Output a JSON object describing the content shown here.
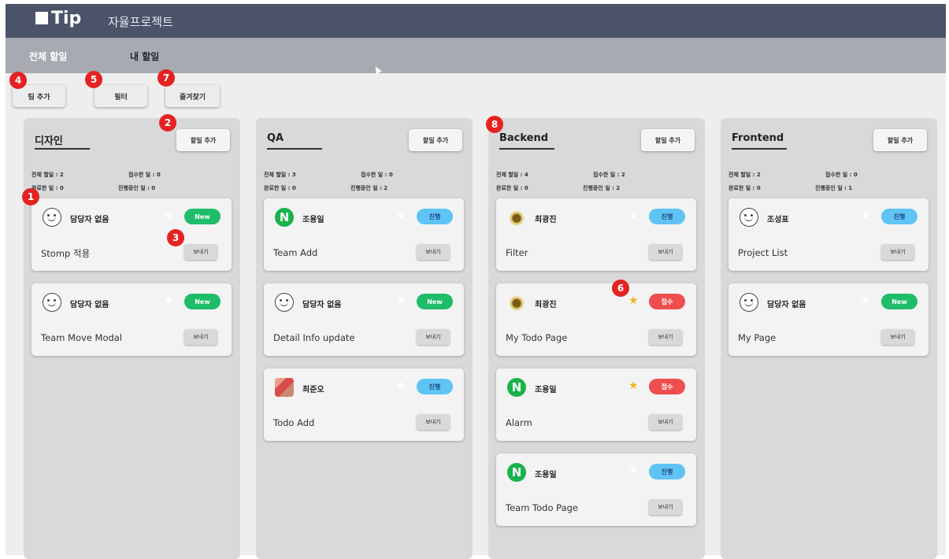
{
  "header": {
    "logo": "Tip",
    "app_title": "자율프로젝트"
  },
  "tabs": [
    {
      "label": "전체 할일"
    },
    {
      "label": "내 할일"
    }
  ],
  "toolbar": {
    "add_team": "팀 추가",
    "filter": "필터",
    "favorites": "즐겨찾기"
  },
  "markers": [
    "1",
    "2",
    "3",
    "4",
    "5",
    "6",
    "7",
    "8"
  ],
  "columns": [
    {
      "title": "디자인",
      "add_label": "할일 추가",
      "stats": {
        "total": "전체 할일 : 2",
        "received": "접수한 일 : 0",
        "done": "완료한 일 : 0",
        "in_progress": "진행중인 일 : 0"
      },
      "cards": [
        {
          "assignee": "담당자 없음",
          "avatar": "smile-icon",
          "status": "New",
          "favorite": false,
          "todo": "Stomp 적용",
          "send": "보내기"
        },
        {
          "assignee": "담당자 없음",
          "avatar": "smile-icon",
          "status": "New",
          "favorite": false,
          "todo": "Team Move Modal",
          "send": "보내기"
        }
      ]
    },
    {
      "title": "QA",
      "add_label": "할일 추가",
      "stats": {
        "total": "전체 할일 : 3",
        "received": "접수한 일 : 0",
        "done": "완료한 일 : 0",
        "in_progress": "진행중인 일 : 2"
      },
      "cards": [
        {
          "assignee": "조용일",
          "avatar": "naver-icon",
          "status": "진행",
          "favorite": false,
          "todo": "Team Add",
          "send": "보내기"
        },
        {
          "assignee": "담당자 없음",
          "avatar": "smile-icon",
          "status": "New",
          "favorite": false,
          "todo": "Detail Info update",
          "send": "보내기"
        },
        {
          "assignee": "최준오",
          "avatar": "pixel-avatar-icon",
          "status": "진행",
          "favorite": false,
          "todo": "Todo Add",
          "send": "보내기"
        }
      ]
    },
    {
      "title": "Backend",
      "add_label": "할일 추가",
      "stats": {
        "total": "전체 할일 : 4",
        "received": "접수한 일 : 2",
        "done": "완료한 일 : 0",
        "in_progress": "진행중인 일 : 2"
      },
      "cards": [
        {
          "assignee": "최광진",
          "avatar": "bird-icon",
          "status": "진행",
          "favorite": false,
          "todo": "Filter",
          "send": "보내기"
        },
        {
          "assignee": "최광진",
          "avatar": "bird-icon",
          "status": "접수",
          "favorite": true,
          "todo": "My Todo Page",
          "send": "보내기"
        },
        {
          "assignee": "조용일",
          "avatar": "naver-icon",
          "status": "접수",
          "favorite": true,
          "todo": "Alarm",
          "send": "보내기"
        },
        {
          "assignee": "조용일",
          "avatar": "naver-icon",
          "status": "진행",
          "favorite": false,
          "todo": "Team Todo Page",
          "send": "보내기"
        }
      ]
    },
    {
      "title": "Frontend",
      "add_label": "할일 추가",
      "stats": {
        "total": "전체 할일 : 2",
        "received": "접수한 일 : 0",
        "done": "완료한 일 : 0",
        "in_progress": "진행중인 일 : 1"
      },
      "cards": [
        {
          "assignee": "조성표",
          "avatar": "smile-icon",
          "status": "진행",
          "favorite": false,
          "todo": "Project List",
          "send": "보내기"
        },
        {
          "assignee": "담당자 없음",
          "avatar": "smile-icon",
          "status": "New",
          "favorite": false,
          "todo": "My Page",
          "send": "보내기"
        }
      ]
    }
  ],
  "colors": {
    "topbar": "#4a5368",
    "tabbar": "#a7aab1",
    "new": "#1fbd6a",
    "progress": "#5fc4f5",
    "received": "#ee4e4e",
    "marker": "#e52222",
    "star": "#f0b429"
  }
}
